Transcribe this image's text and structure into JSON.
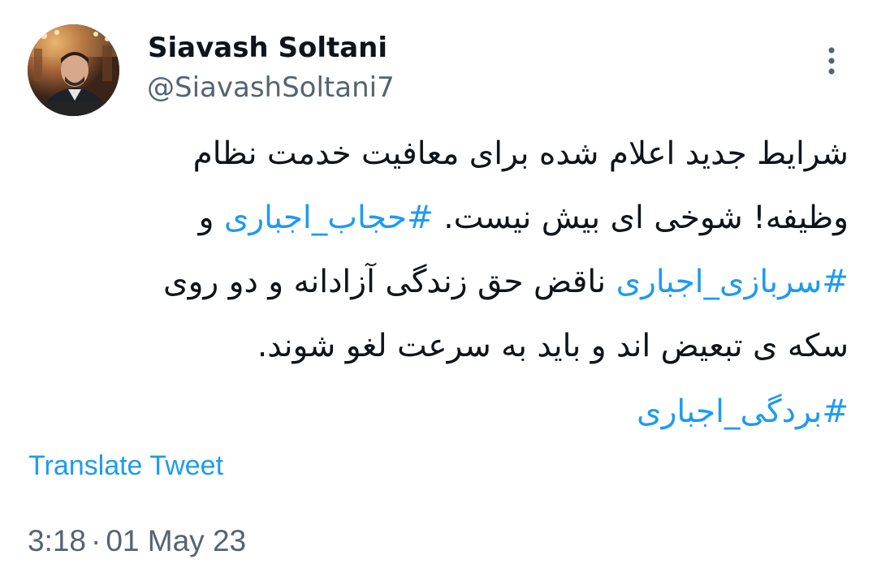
{
  "author": {
    "display_name": "Siavash Soltani",
    "handle": "@SiavashSoltani7",
    "avatar_icon": "profile-photo"
  },
  "more_icon": "more-vertical-icon",
  "tweet": {
    "line1": "شرایط جدید اعلام شده برای معافیت خدمت نظام",
    "line2_text": "وظیفه! شوخی ای بیش نیست.",
    "line2_hashtag": "#حجاب_اجباری",
    "line2_tail": "و",
    "line3_hashtag": "#سربازی_اجباری",
    "line3_text": "ناقض حق زندگی آزادانه و دو روی",
    "line4": "سکه ی تبعیض اند و باید به سرعت لغو شوند.",
    "line5_hashtag": "#بردگی_اجباری"
  },
  "translate_label": "Translate Tweet",
  "meta": {
    "time": "3:18",
    "separator": "·",
    "date": "01 May 23"
  },
  "colors": {
    "link": "#1d9bf0",
    "secondary": "#536471",
    "primary_text": "#0f1419"
  }
}
